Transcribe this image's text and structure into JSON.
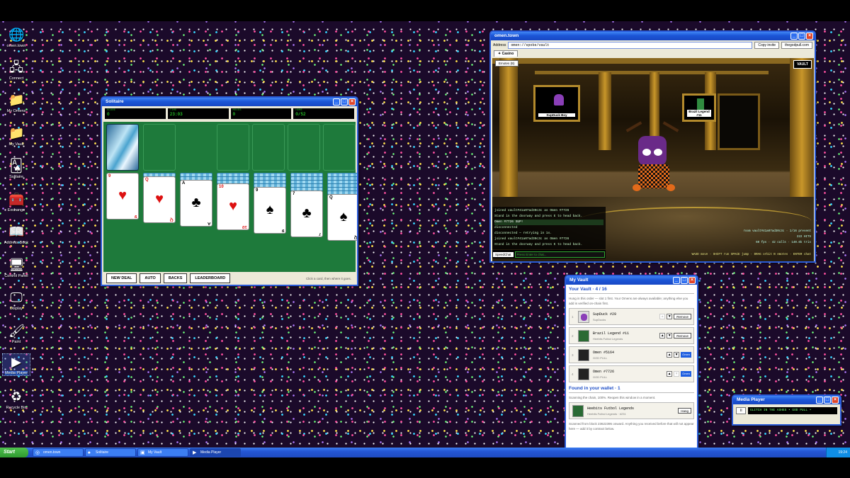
{
  "desktop_icons": [
    {
      "label": "omen.town",
      "icon": "globe-icon"
    },
    {
      "label": "Connect",
      "icon": "network-icon"
    },
    {
      "label": "My Omens",
      "icon": "folder-icon"
    },
    {
      "label": "My Vault",
      "icon": "folder-icon"
    },
    {
      "label": "Solitaire",
      "icon": "cards-icon"
    },
    {
      "label": "Exchange",
      "icon": "chest-icon"
    },
    {
      "label": "Address Book",
      "icon": "book-icon"
    },
    {
      "label": "Control Panel",
      "icon": "control-panel-icon"
    },
    {
      "label": "Display",
      "icon": "display-icon"
    },
    {
      "label": "Paint",
      "icon": "paint-icon"
    },
    {
      "label": "Media Player",
      "icon": "media-player-icon"
    },
    {
      "label": "Recycle Bin",
      "icon": "recycle-bin-icon"
    }
  ],
  "solitaire": {
    "title": "Solitaire",
    "stats": [
      {
        "k": "SCORE",
        "v": "0"
      },
      {
        "k": "TIME",
        "v": "23:03"
      },
      {
        "k": "MOVES",
        "v": "0"
      },
      {
        "k": "HOME",
        "v": "0/52"
      }
    ],
    "tableau": [
      {
        "rank": "9",
        "suit": "♥",
        "color": "red",
        "backs": 0
      },
      {
        "rank": "Q",
        "suit": "♥",
        "color": "red",
        "backs": 1
      },
      {
        "rank": "A",
        "suit": "♣",
        "color": "blk",
        "backs": 2
      },
      {
        "rank": "10",
        "suit": "♥",
        "color": "red",
        "backs": 3
      },
      {
        "rank": "9",
        "suit": "♠",
        "color": "blk",
        "backs": 4
      },
      {
        "rank": "7",
        "suit": "♣",
        "color": "blk",
        "backs": 5
      },
      {
        "rank": "Q",
        "suit": "♠",
        "color": "blk",
        "backs": 6
      }
    ],
    "buttons": {
      "new_deal": "NEW DEAL",
      "auto": "AUTO",
      "backs": "BACKS",
      "leaderboard": "LEADERBOARD"
    },
    "hint": "Click a card, then where it goes."
  },
  "omen": {
    "title": "omen.town",
    "address_label": "Address",
    "address": "omen://spoke/vault",
    "copy_invite": "Copy invite",
    "site": "thegodpull.com",
    "tab": "✦ Casino",
    "emotes": "Emotes (B)",
    "vault_btn": "VAULT",
    "frames": [
      "SupDuck Boy",
      "Brazil Legend #11"
    ],
    "chat": [
      "joined vault#41a07ad30c3c as Omen #7726",
      "Stand in the doorway and press E to head back.",
      "Omen #7726 SUP!",
      "disconnected",
      "disconnected — retrying in 1s.",
      "joined vault#41a07ad30c3c as Omen #7726",
      "Stand in the doorway and press E to head back."
    ],
    "speedchat": "SpeedChat",
    "placeholder": "Press Enter to chat...",
    "hud": {
      "room": "room vault#41a07ad30c3c · 1/16 present",
      "hits": "222 HITS",
      "stats": "60 fps · 42 calls · 140.6k tris",
      "controls": "WASD move · SHIFT run SPACE jump · DRAG orbit B emotes · ENTER chat"
    }
  },
  "vault": {
    "title": "My Vault",
    "heading": "Your Vault · 4 / 16",
    "desc": "Hung in this order — slot 1 first. Your Omens are always available; anything else you add is verified on-chain first.",
    "items": [
      {
        "n": "1",
        "name": "SupDuck #29",
        "col": "SupDucks",
        "remove": "Remove"
      },
      {
        "n": "2",
        "name": "Brazil Legend #11",
        "col": "Heebits Futbol Legends",
        "remove": "Remove"
      },
      {
        "n": "3",
        "name": "Omen #5164",
        "col": "GOD PULL",
        "badge": "Omen"
      },
      {
        "n": "4",
        "name": "Omen #7726",
        "col": "GOD PULL",
        "badge": "Omen"
      }
    ],
    "found_heading": "Found in your wallet · 1",
    "found_desc": "Scanning the chain, 100%. Reopen this window in a moment.",
    "found_item": {
      "name": "Heebits Futbol Legends",
      "col": "Heebits Futbol Legends · #231",
      "btn": "Hang"
    },
    "footer": "Scanned from block 23622395 onward. Anything you received before that will not appear here — add it by contract below."
  },
  "media": {
    "title": "Media Player",
    "track": "GLITCH IN THE ASHES • GOD PULL •"
  },
  "taskbar": {
    "start": "Start",
    "tasks": [
      "omen.town",
      "Solitaire",
      "My Vault",
      "Media Player"
    ],
    "clock": "19:24"
  }
}
